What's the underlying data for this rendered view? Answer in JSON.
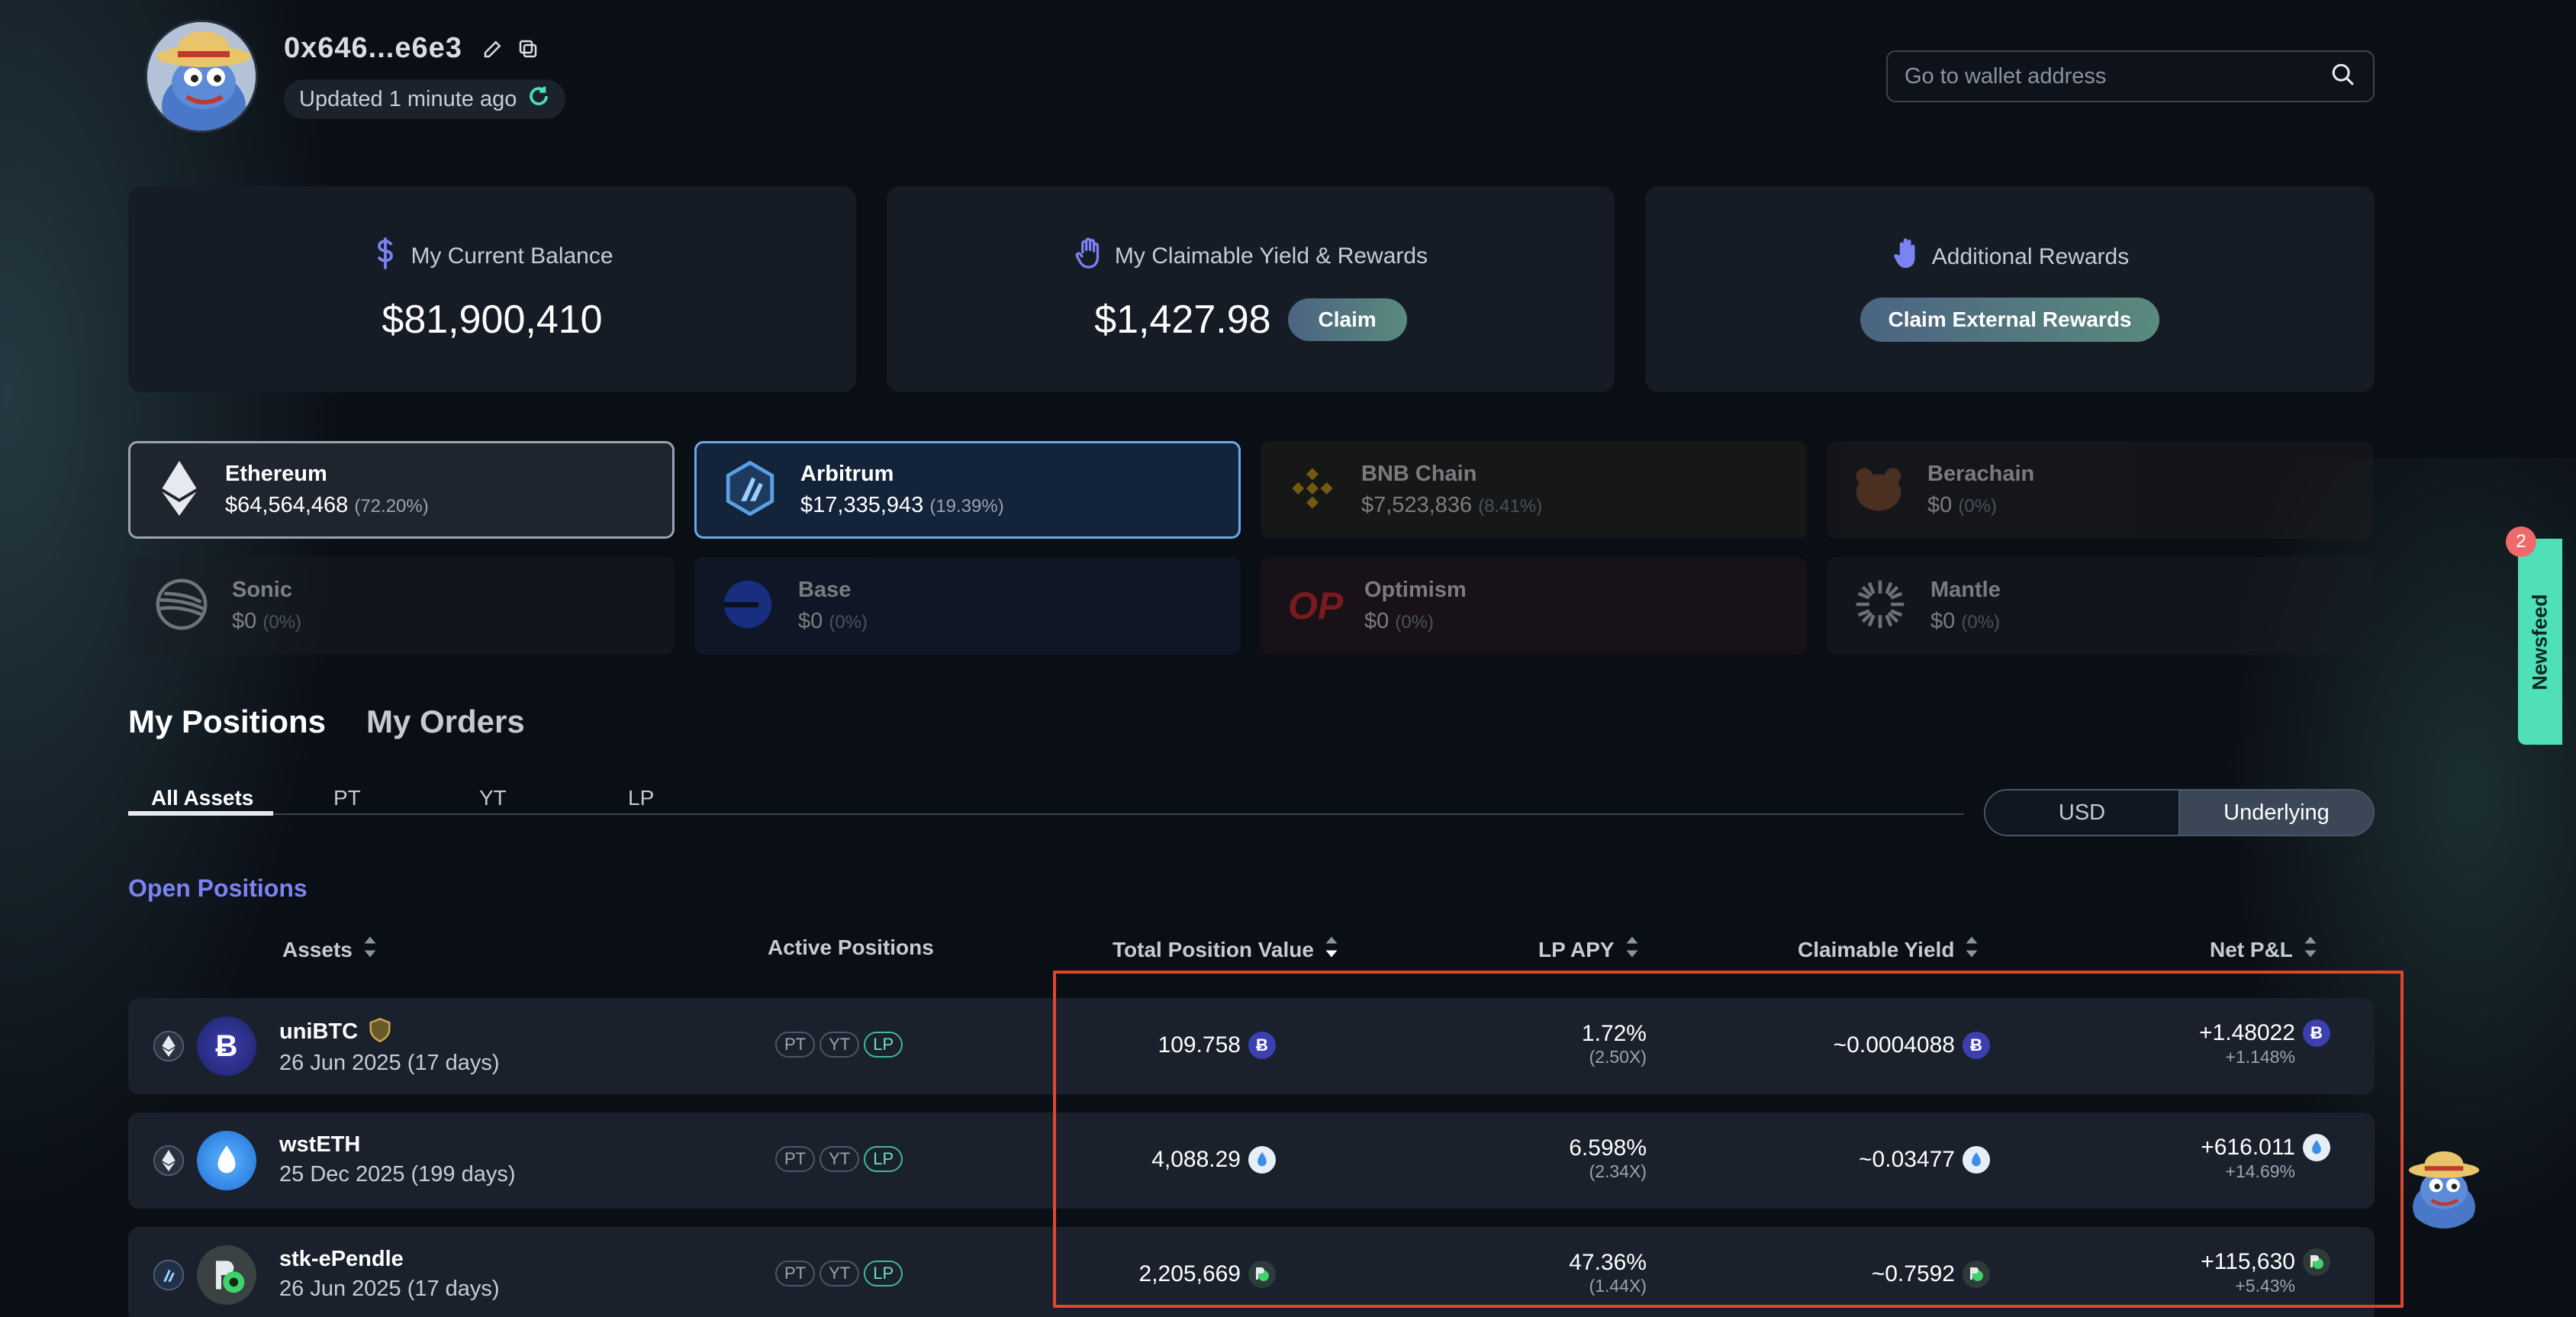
{
  "header": {
    "wallet_address": "0x646...e6e3",
    "updated_text": "Updated 1 minute ago",
    "search_placeholder": "Go to wallet address"
  },
  "summary": {
    "balance": {
      "title": "My Current Balance",
      "value": "$81,900,410"
    },
    "claimable": {
      "title": "My Claimable Yield & Rewards",
      "value": "$1,427.98",
      "button": "Claim"
    },
    "additional": {
      "title": "Additional Rewards",
      "button": "Claim External Rewards"
    }
  },
  "chains": [
    {
      "name": "Ethereum",
      "value": "$64,564,468",
      "pct": "(72.20%)",
      "icon": "ethereum-icon"
    },
    {
      "name": "Arbitrum",
      "value": "$17,335,943",
      "pct": "(19.39%)",
      "icon": "arbitrum-icon"
    },
    {
      "name": "BNB Chain",
      "value": "$7,523,836",
      "pct": "(8.41%)",
      "icon": "bnb-icon"
    },
    {
      "name": "Berachain",
      "value": "$0",
      "pct": "(0%)",
      "icon": "berachain-icon"
    },
    {
      "name": "Sonic",
      "value": "$0",
      "pct": "(0%)",
      "icon": "sonic-icon"
    },
    {
      "name": "Base",
      "value": "$0",
      "pct": "(0%)",
      "icon": "base-icon"
    },
    {
      "name": "Optimism",
      "value": "$0",
      "pct": "(0%)",
      "icon": "optimism-icon",
      "logo_text": "OP"
    },
    {
      "name": "Mantle",
      "value": "$0",
      "pct": "(0%)",
      "icon": "mantle-icon"
    }
  ],
  "tabs": {
    "positions": "My Positions",
    "orders": "My Orders"
  },
  "sub_tabs": [
    "All Assets",
    "PT",
    "YT",
    "LP"
  ],
  "toggle": {
    "usd": "USD",
    "underlying": "Underlying",
    "selected": "Underlying"
  },
  "section_title": "Open Positions",
  "table": {
    "headers": {
      "assets": "Assets",
      "active": "Active Positions",
      "total": "Total Position Value",
      "lp_apy": "LP APY",
      "claimable": "Claimable Yield",
      "pnl": "Net P&L"
    },
    "badges": [
      "PT",
      "YT",
      "LP"
    ],
    "rows": [
      {
        "name": "uniBTC",
        "date": "26 Jun 2025 (17 days)",
        "total": "109.758",
        "apy": "1.72%",
        "apy_mult": "(2.50X)",
        "claimable": "~0.0004088",
        "pnl": "+1.48022",
        "pnl_pct": "+1.148%",
        "coin_color": "#3b3fb0"
      },
      {
        "name": "wstETH",
        "date": "25 Dec 2025 (199 days)",
        "total": "4,088.29",
        "apy": "6.598%",
        "apy_mult": "(2.34X)",
        "claimable": "~0.03477",
        "pnl": "+616.011",
        "pnl_pct": "+14.69%",
        "coin_color": "#e8eef6"
      },
      {
        "name": "stk-ePendle",
        "date": "26 Jun 2025 (17 days)",
        "total": "2,205,669",
        "apy": "47.36%",
        "apy_mult": "(1.44X)",
        "claimable": "~0.7592",
        "pnl": "+115,630",
        "pnl_pct": "+5.43%",
        "coin_color": "#2f3a3a"
      }
    ]
  },
  "newsfeed": {
    "label": "Newsfeed",
    "count": "2"
  },
  "colors": {
    "accent": "#7b83f2",
    "lp": "#42b89a",
    "highlight": "#e0452e"
  }
}
